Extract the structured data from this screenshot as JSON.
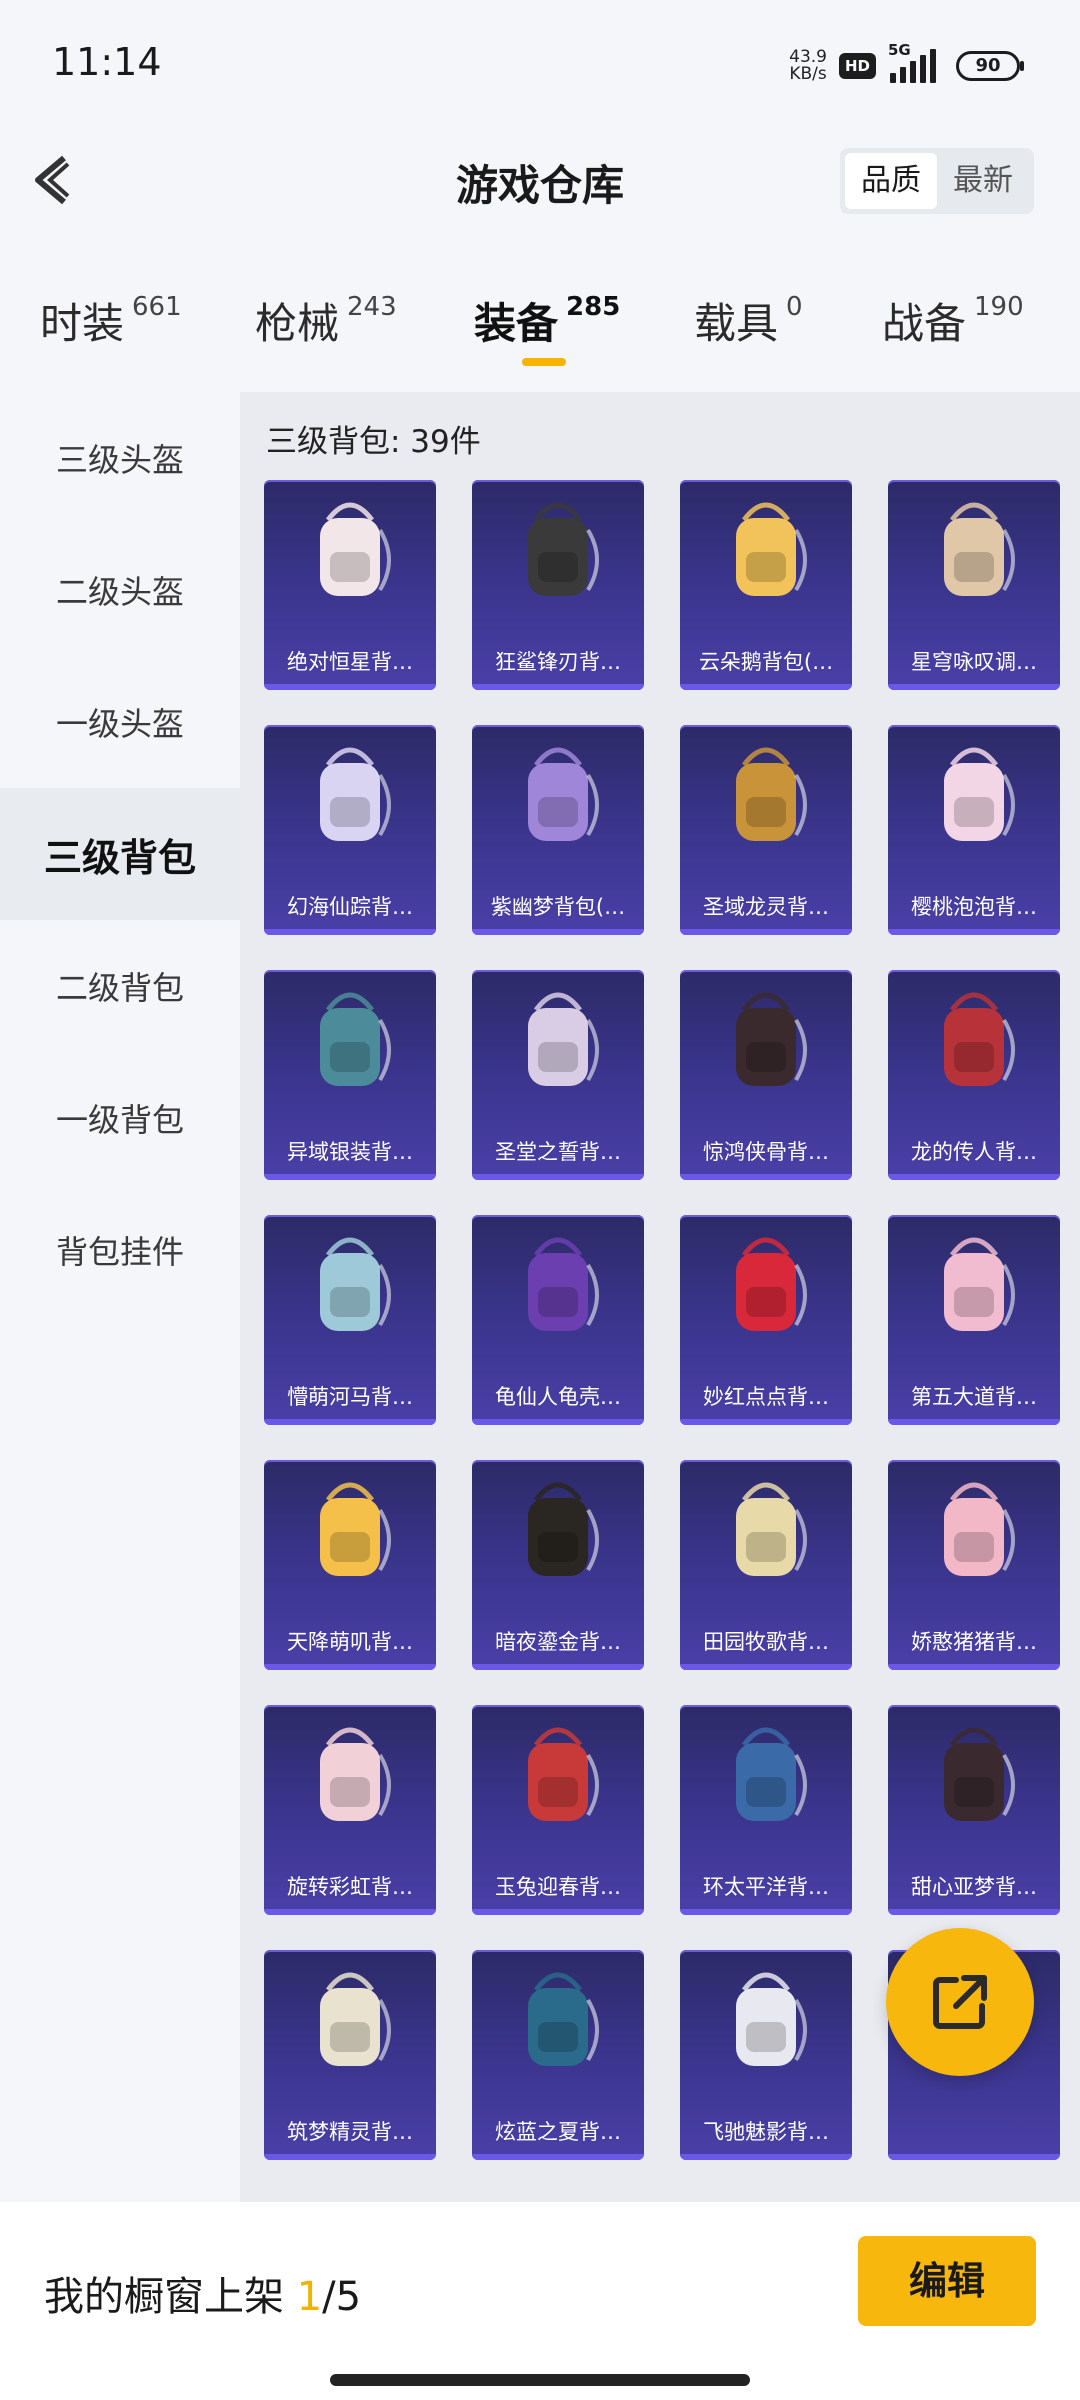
{
  "status": {
    "time": "11:14",
    "net_speed_value": "43.9",
    "net_speed_unit": "KB/s",
    "hd": "HD",
    "network": "5G",
    "battery": "90"
  },
  "header": {
    "title": "游戏仓库",
    "sort_options": [
      "品质",
      "最新"
    ],
    "sort_active": "品质"
  },
  "tabs": [
    {
      "label": "时装",
      "count": "661"
    },
    {
      "label": "枪械",
      "count": "243"
    },
    {
      "label": "装备",
      "count": "285",
      "active": true
    },
    {
      "label": "载具",
      "count": "0"
    },
    {
      "label": "战备",
      "count": "190"
    }
  ],
  "sidenav": {
    "items": [
      "三级头盔",
      "二级头盔",
      "一级头盔",
      "三级背包",
      "二级背包",
      "一级背包",
      "背包挂件"
    ],
    "active": "三级背包"
  },
  "content": {
    "section_title": "三级背包: 39件",
    "items": [
      "绝对恒星背…",
      "狂鲨锋刃背…",
      "云朵鹅背包(…",
      "星穹咏叹调…",
      "幻海仙踪背…",
      "紫幽梦背包(…",
      "圣域龙灵背…",
      "樱桃泡泡背…",
      "异域银装背…",
      "圣堂之誓背…",
      "惊鸿侠骨背…",
      "龙的传人背…",
      "懵萌河马背…",
      "龟仙人龟壳…",
      "妙红点点背…",
      "第五大道背…",
      "天降萌叽背…",
      "暗夜鎏金背…",
      "田园牧歌背…",
      "娇憨猪猪背…",
      "旋转彩虹背…",
      "玉兔迎春背…",
      "环太平洋背…",
      "甜心亚梦背…",
      "筑梦精灵背…",
      "炫蓝之夏背…",
      "飞驰魅影背…",
      ""
    ],
    "item_colors": [
      "#f3e6e8",
      "#3a3a3a",
      "#f2c35a",
      "#e0c7a8",
      "#d9d4f2",
      "#9f86d9",
      "#c9933a",
      "#f3d6e6",
      "#4c8c9a",
      "#d9cde6",
      "#3a2a2e",
      "#b8323a",
      "#9ec9d8",
      "#6b3fb0",
      "#d8283a",
      "#f2bcd0",
      "#f5c04a",
      "#2a2622",
      "#e8d9a8",
      "#f2b8c8",
      "#f2d0d8",
      "#c83a3a",
      "#3a6aa8",
      "#3a2a30",
      "#e8e2cf",
      "#2a6a8a",
      "#e8e8f0",
      "#cfd2d8"
    ]
  },
  "bottom": {
    "showcase_label": "我的橱窗上架",
    "showcase_current": "1",
    "showcase_total": "/5",
    "edit_label": "编辑"
  }
}
